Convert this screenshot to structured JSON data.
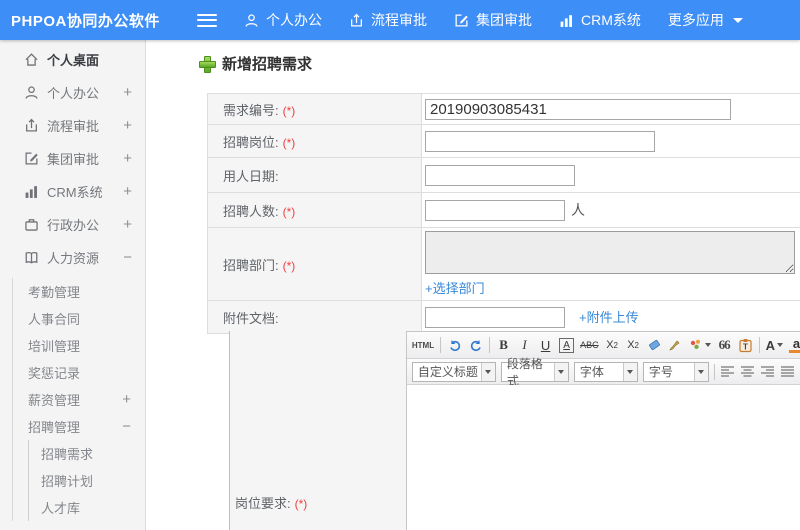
{
  "header": {
    "brand": "PHPOA协同办公软件",
    "nav": [
      {
        "label": "个人办公"
      },
      {
        "label": "流程审批"
      },
      {
        "label": "集团审批"
      },
      {
        "label": "CRM系统"
      },
      {
        "label": "更多应用"
      }
    ]
  },
  "sidebar": {
    "items": [
      {
        "label": "个人桌面"
      },
      {
        "label": "个人办公",
        "expander": "+"
      },
      {
        "label": "流程审批",
        "expander": "+"
      },
      {
        "label": "集团审批",
        "expander": "+"
      },
      {
        "label": "CRM系统",
        "expander": "+"
      },
      {
        "label": "行政办公",
        "expander": "+"
      },
      {
        "label": "人力资源",
        "expander": "−"
      }
    ],
    "hr_children": [
      {
        "label": "考勤管理"
      },
      {
        "label": "人事合同"
      },
      {
        "label": "培训管理"
      },
      {
        "label": "奖惩记录"
      },
      {
        "label": "薪资管理",
        "expander": "+"
      },
      {
        "label": "招聘管理",
        "expander": "−"
      }
    ],
    "recruit_children": [
      {
        "label": "招聘需求"
      },
      {
        "label": "招聘计划"
      },
      {
        "label": "人才库"
      }
    ]
  },
  "main": {
    "title": "新增招聘需求",
    "required_mark": "(*)",
    "form": {
      "rows": [
        {
          "label": "需求编号:",
          "value": "20190903085431"
        },
        {
          "label": "招聘岗位:"
        },
        {
          "label": "用人日期:"
        },
        {
          "label": "招聘人数:",
          "suffix": "人"
        },
        {
          "label": "招聘部门:",
          "link": "+选择部门"
        },
        {
          "label": "附件文档:",
          "link": "+附件上传"
        },
        {
          "label": "岗位要求:"
        }
      ]
    },
    "editor": {
      "toolbar": {
        "html": "HTML",
        "bold": "B",
        "italic": "I",
        "underline": "U",
        "font_badge": "A",
        "strike": "ABC",
        "sup_base": "X",
        "sup_exp": "2",
        "sub_base": "X",
        "sub_exp": "2",
        "quote": "66",
        "font_color": "A",
        "back_color": "a"
      },
      "dropdowns": [
        {
          "label": "自定义标题"
        },
        {
          "label": "段落格式"
        },
        {
          "label": "字体"
        },
        {
          "label": "字号"
        }
      ]
    }
  },
  "colors": {
    "header_bg": "#3e8ef7",
    "link_blue": "#3788d8",
    "required_red": "#f03e3e",
    "accent_green": "#58a829"
  }
}
